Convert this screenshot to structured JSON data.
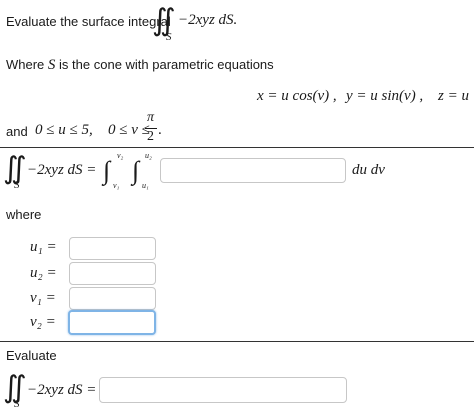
{
  "header": {
    "prompt": "Evaluate the surface integral",
    "integrand": "−2xyz dS.",
    "surface": "S"
  },
  "description": {
    "prefix": "Where",
    "surface": "S",
    "rest": "is the cone with parametric equations"
  },
  "equations": {
    "x": "x = u cos(v) ,",
    "y": "y = u sin(v) ,",
    "z": "z = u"
  },
  "bounds": {
    "u_range": "0 ≤ u ≤ 5,",
    "v_range": "0 ≤ v ≤",
    "prefix": "and",
    "pi": "π",
    "two": "2",
    "period": "."
  },
  "integral_setup": {
    "lhs": "−2xyz dS =",
    "sub_s": "S",
    "v2": "v₂",
    "v1": "v₁",
    "u2": "u₂",
    "u1": "u₁",
    "differentials": "du dv",
    "integrand_value": ""
  },
  "where_label": "where",
  "limits": [
    {
      "label": "u₁ =",
      "value": ""
    },
    {
      "label": "u₂ =",
      "value": ""
    },
    {
      "label": "v₁ =",
      "value": ""
    },
    {
      "label": "v₂ =",
      "value": ""
    }
  ],
  "evaluate": {
    "label": "Evaluate",
    "lhs": "−2xyz dS =",
    "sub_s": "S",
    "value": ""
  }
}
